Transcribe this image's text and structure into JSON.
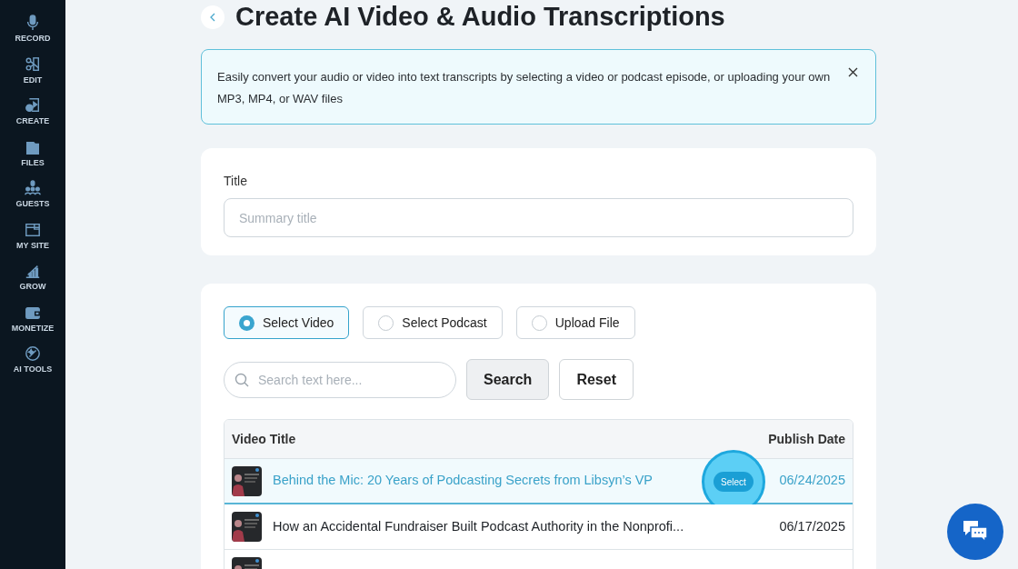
{
  "sidebar": {
    "items": [
      {
        "label": "RECORD"
      },
      {
        "label": "EDIT"
      },
      {
        "label": "CREATE"
      },
      {
        "label": "FILES"
      },
      {
        "label": "GUESTS"
      },
      {
        "label": "MY SITE"
      },
      {
        "label": "GROW"
      },
      {
        "label": "MONETIZE"
      },
      {
        "label": "AI TOOLS"
      }
    ]
  },
  "page": {
    "title": "Create AI Video & Audio Transcriptions"
  },
  "info": {
    "text": "Easily convert your audio or video into text transcripts by selecting a video or podcast episode, or uploading your own MP3, MP4, or WAV files"
  },
  "title_field": {
    "label": "Title",
    "placeholder": "Summary title"
  },
  "source_options": [
    {
      "label": "Select Video",
      "selected": true
    },
    {
      "label": "Select Podcast",
      "selected": false
    },
    {
      "label": "Upload File",
      "selected": false
    }
  ],
  "search": {
    "placeholder": "Search text here...",
    "search_button": "Search",
    "reset_button": "Reset"
  },
  "table": {
    "columns": [
      "Video Title",
      "Publish Date"
    ],
    "rows": [
      {
        "title": "Behind the Mic: 20 Years of Podcasting Secrets from Libsyn’s VP",
        "date": "06/24/2025",
        "selected": true,
        "action": "Select"
      },
      {
        "title": "How an Accidental Fundraiser Built Podcast Authority in the Nonprofi...",
        "date": "06/17/2025",
        "selected": false
      },
      {
        "selected": false
      }
    ]
  }
}
